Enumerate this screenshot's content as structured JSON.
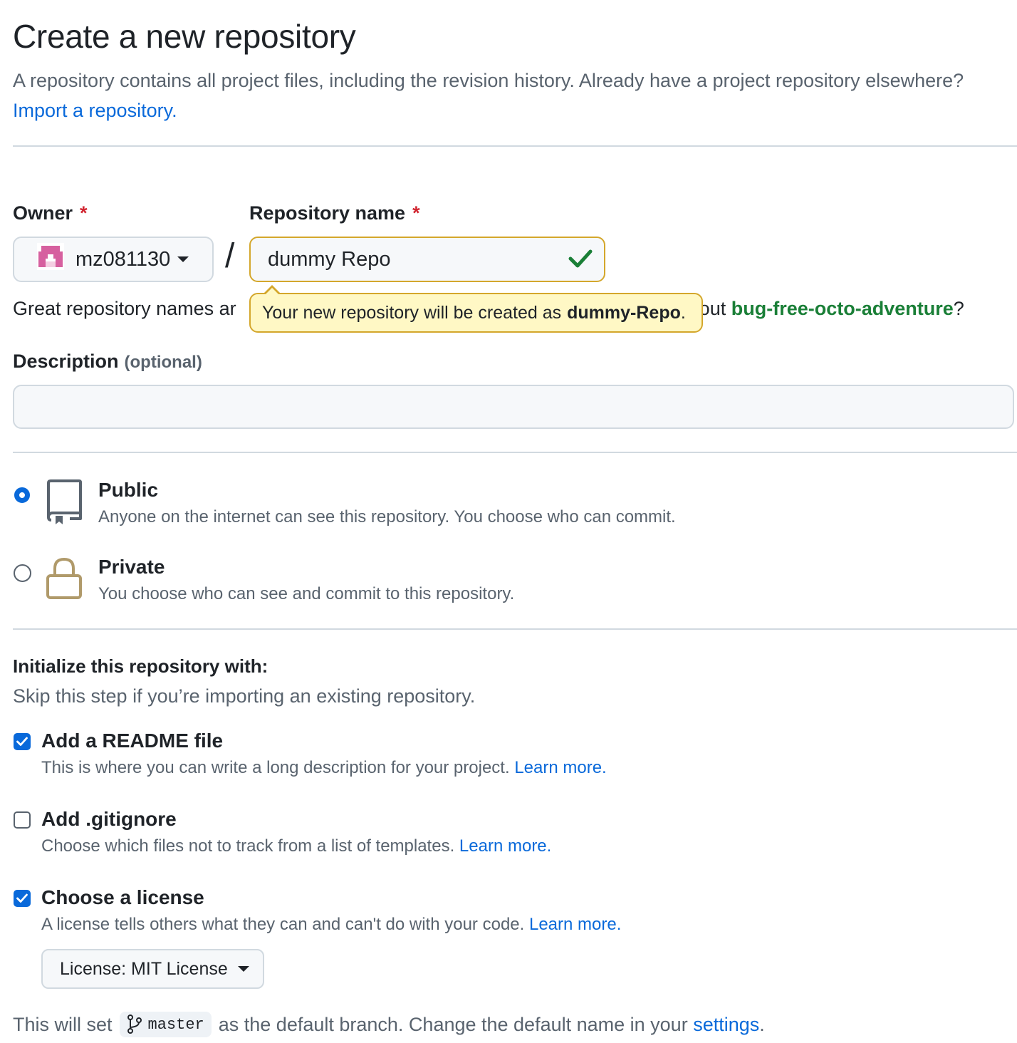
{
  "header": {
    "title": "Create a new repository",
    "lead": "A repository contains all project files, including the revision history. Already have a project repository elsewhere?",
    "import_link": "Import a repository."
  },
  "owner": {
    "label": "Owner",
    "required_mark": "*",
    "value": "mz081130"
  },
  "repo_name": {
    "label": "Repository name",
    "required_mark": "*",
    "value": "dummy Repo",
    "separator": "/",
    "tooltip_prefix": "Your new repository will be created as",
    "tooltip_name": "dummy-Repo",
    "tooltip_suffix": "."
  },
  "hint": {
    "visible_start": "Great repository names ar",
    "visible_end": "bout",
    "suggestion": "bug-free-octo-adventure",
    "suffix": "?"
  },
  "description": {
    "label": "Description",
    "optional": "(optional)",
    "value": ""
  },
  "visibility": {
    "selected": "public",
    "options": [
      {
        "id": "public",
        "title": "Public",
        "desc": "Anyone on the internet can see this repository. You choose who can commit.",
        "icon": "repo-icon"
      },
      {
        "id": "private",
        "title": "Private",
        "desc": "You choose who can see and commit to this repository.",
        "icon": "lock-icon"
      }
    ]
  },
  "initialize": {
    "heading": "Initialize this repository with:",
    "subtext": "Skip this step if you’re importing an existing repository.",
    "options": [
      {
        "title": "Add a README file",
        "desc": "This is where you can write a long description for your project.",
        "link": "Learn more.",
        "checked": true
      },
      {
        "title": "Add .gitignore",
        "desc": "Choose which files not to track from a list of templates.",
        "link": "Learn more.",
        "checked": false
      },
      {
        "title": "Choose a license",
        "desc": "A license tells others what they can and can't do with your code.",
        "link": "Learn more.",
        "checked": true
      }
    ],
    "license_button": "License: MIT License"
  },
  "footer": {
    "prefix": "This will set",
    "branch": "master",
    "middle": "as the default branch. Change the default name in your",
    "link": "settings",
    "suffix": "."
  },
  "colors": {
    "accent": "#0969da",
    "valid_check": "#1a7f37",
    "required": "#d1242f",
    "tooltip_bg": "#fff8c5",
    "tooltip_border": "#d4a72c"
  }
}
